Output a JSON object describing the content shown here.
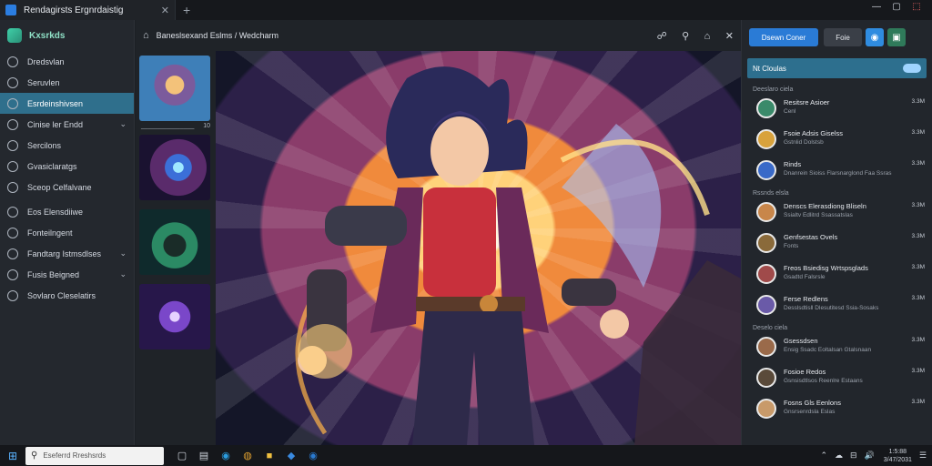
{
  "window": {
    "tab_title": "Rendagirsts Ergnrdaistig",
    "close": "✕",
    "new_tab": "+"
  },
  "sidebar": {
    "brand": "Kxsrkds",
    "items": [
      {
        "label": "Dredsvlan",
        "chevron": ""
      },
      {
        "label": "Seruvlen",
        "chevron": ""
      },
      {
        "label": "Esrdeinshivsen",
        "chevron": ""
      },
      {
        "label": "Cinise ler Endd",
        "chevron": "⌄"
      },
      {
        "label": "Sercilons",
        "chevron": ""
      },
      {
        "label": "Gvasiclaratgs",
        "chevron": ""
      },
      {
        "label": "Sceop Celfalvane",
        "chevron": ""
      },
      {
        "label": "Eos Elensdiiwe",
        "chevron": ""
      },
      {
        "label": "Fonteilngent",
        "chevron": ""
      },
      {
        "label": "Fandtarg Istmsdlses",
        "chevron": "⌄"
      },
      {
        "label": "Fusis Beigned",
        "chevron": "⌄"
      },
      {
        "label": "Sovlaro Cleselatirs",
        "chevron": ""
      }
    ]
  },
  "header": {
    "home": "⌂",
    "breadcrumb": "Baneslsexand Eslms / Wedcharm",
    "icons": [
      "☍",
      "⚲",
      "⌂",
      "✕"
    ]
  },
  "thumbnails": [
    {
      "caption_left": "_______________",
      "caption_right": "10"
    },
    {
      "caption_left": "",
      "caption_right": ""
    },
    {
      "caption_left": "",
      "caption_right": ""
    },
    {
      "caption_left": "",
      "caption_right": ""
    }
  ],
  "right_panel": {
    "primary_button": "Dsewn Coner",
    "secondary_button": "Foie",
    "window_controls": [
      "—",
      "▢",
      "⬚"
    ],
    "chat_header": "Nt Cloulas",
    "sections": [
      {
        "label": "Deeslaro ciela",
        "messages": [
          {
            "name": "Resitsre Asioer",
            "text": "Cenl",
            "time": "3.3M",
            "avatar_color": "#3a8a6a"
          },
          {
            "name": "Fsoie Adsis Giselss",
            "text": "Gstnlid Dolstsb",
            "time": "3.3M",
            "avatar_color": "#d8a23c"
          },
          {
            "name": "Rinds",
            "text": "Dnanrein Sioiss Flarsnarglond Faa Ssras",
            "time": "3.3M",
            "avatar_color": "#3a6ac8"
          }
        ]
      },
      {
        "label": "Rssnds elsla",
        "messages": [
          {
            "name": "Denscs Elerasdiong Bliseln",
            "text": "Ssialtv Edlitrd Ssassatslas",
            "time": "3.3M",
            "avatar_color": "#c8864a"
          },
          {
            "name": "Genfsestas Ovels",
            "text": "Fonts",
            "time": "3.3M",
            "avatar_color": "#8a6a3a"
          },
          {
            "name": "Freos Bsiedisg Wrtspsglads",
            "text": "Gsadtd Falsrsle",
            "time": "3.3M",
            "avatar_color": "#a04a4a"
          },
          {
            "name": "Ferse Redlens",
            "text": "Desslsdtisll Dlesutitesd Ssia-Sosaks",
            "time": "3.3M",
            "avatar_color": "#6a5aa8"
          }
        ]
      },
      {
        "label": "Deselo ciela",
        "messages": [
          {
            "name": "Gsessdsen",
            "text": "Ensig Ssadc Eoltalsan Gtalsnaan",
            "time": "3.3M",
            "avatar_color": "#9a6a4a"
          },
          {
            "name": "Fosioe Redos",
            "text": "Gsnsisdtlsos Reenlre Estaans",
            "time": "3.3M",
            "avatar_color": "#5a4a3a"
          },
          {
            "name": "Fosns Gls Eenlons",
            "text": "Gnsrsenrdsla Eslas",
            "time": "3.3M",
            "avatar_color": "#c89a6a"
          }
        ]
      }
    ]
  },
  "taskbar": {
    "start": "⊞",
    "search_placeholder": "Eseferrd Rreshsrds",
    "search_icon": "⚲",
    "apps": [
      {
        "glyph": "▢",
        "color": "#cfd5dd"
      },
      {
        "glyph": "▤",
        "color": "#cfd5dd"
      },
      {
        "glyph": "◉",
        "color": "#2a9de0"
      },
      {
        "glyph": "◍",
        "color": "#e0a030"
      },
      {
        "glyph": "■",
        "color": "#f0c040"
      },
      {
        "glyph": "◆",
        "color": "#3a8ae0"
      },
      {
        "glyph": "◉",
        "color": "#2a7ad0"
      }
    ],
    "tray": [
      "⌃",
      "☁",
      "⊟",
      "🔊"
    ],
    "clock_time": "1:5:88",
    "clock_date": "3/47/2031",
    "notifications": "☰"
  },
  "colors": {
    "accent": "#2a7bd6",
    "sidebar_active": "#2f6f8c",
    "chat_header": "#2d6f8e"
  }
}
